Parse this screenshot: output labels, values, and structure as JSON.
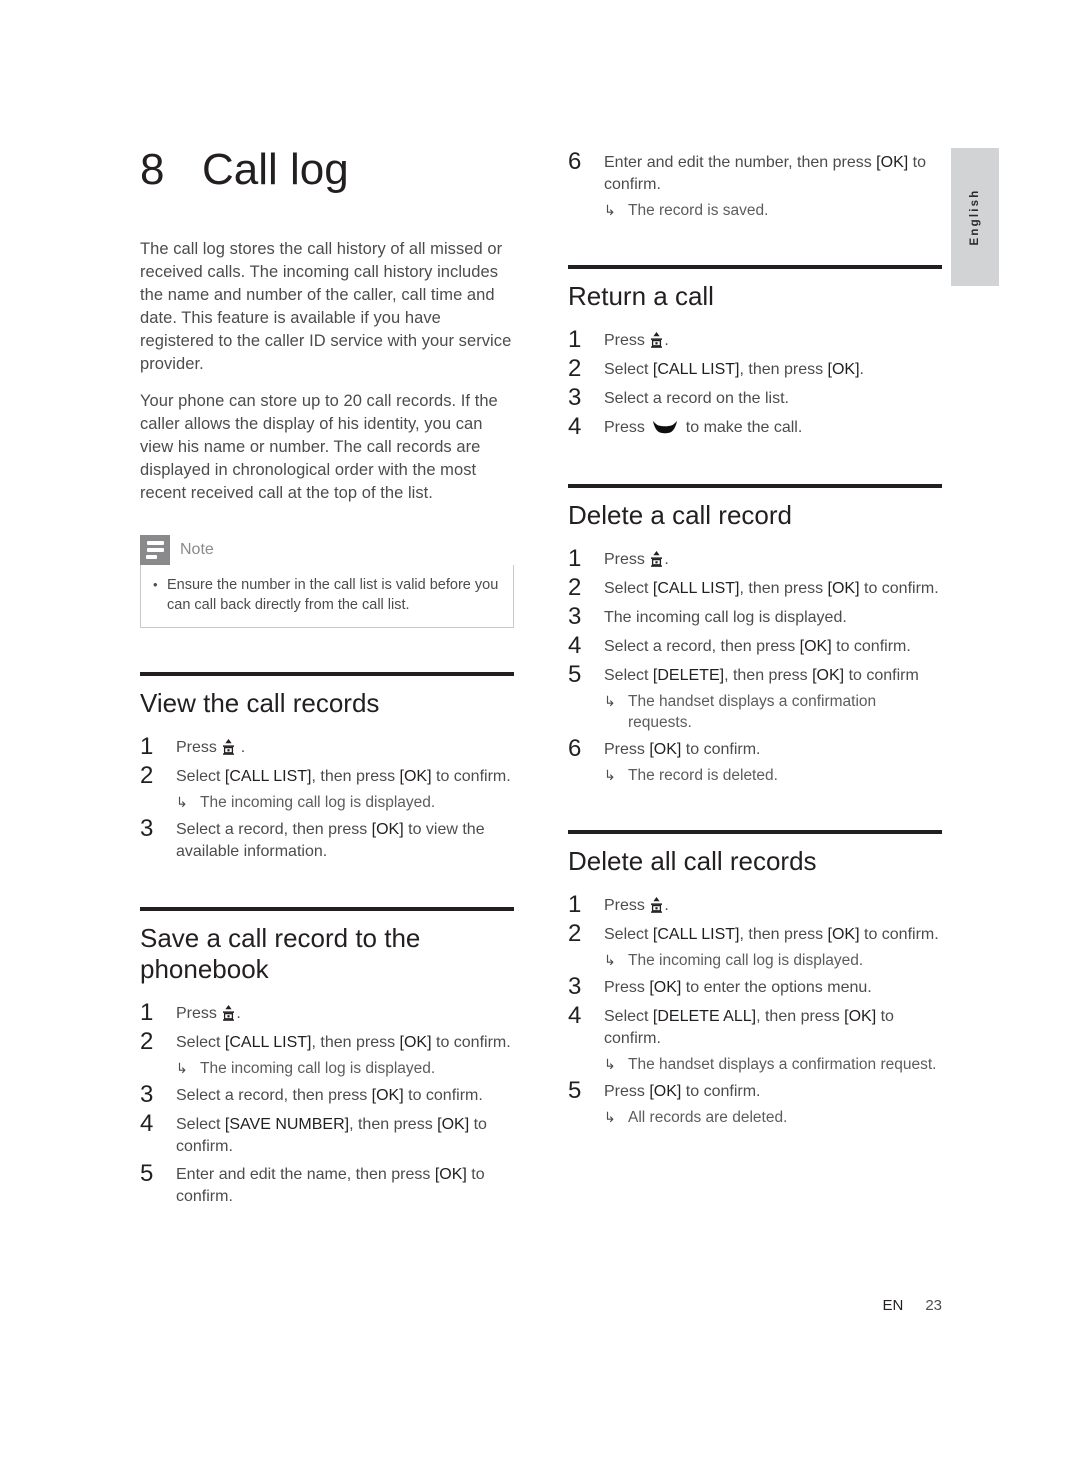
{
  "page": {
    "language_tab": "English",
    "footer": {
      "locale_code": "EN",
      "page_number": "23"
    }
  },
  "chapter": {
    "number": "8",
    "title": "Call log"
  },
  "intro": {
    "paragraph_1": "The call log stores the call history of all missed or received calls. The incoming call history includes the name and number of the caller, call time and date. This feature is available if you have registered to the caller ID service with your service provider.",
    "paragraph_2": "Your phone can store up to 20 call records. If the caller allows the display of his identity, you can view his name or number. The call records are displayed in chronological order with the most recent received call at the top of the list."
  },
  "note": {
    "label": "Note",
    "bullet": "•",
    "items": [
      "Ensure the number in the call list is valid before you can call back directly from the call list."
    ]
  },
  "sections": {
    "view_records": {
      "title": "View the call records",
      "steps": [
        {
          "num": "1",
          "pre": "Press ",
          "icon": "menu-key-icon",
          "post": " ."
        },
        {
          "num": "2",
          "text_parts": [
            "Select ",
            "[CALL LIST]",
            ", then press ",
            "[OK]",
            " to confirm."
          ],
          "result": "The incoming call log is displayed."
        },
        {
          "num": "3",
          "text_parts": [
            "Select a record, then press ",
            "[OK]",
            " to view the available information."
          ]
        }
      ]
    },
    "save_record": {
      "title": "Save a call record to the phonebook",
      "steps": [
        {
          "num": "1",
          "pre": "Press ",
          "icon": "menu-key-icon",
          "post": "."
        },
        {
          "num": "2",
          "text_parts": [
            "Select ",
            "[CALL LIST]",
            ", then press ",
            "[OK]",
            " to confirm."
          ],
          "result": "The incoming call log is displayed."
        },
        {
          "num": "3",
          "text_parts": [
            "Select a record, then press ",
            "[OK]",
            " to confirm."
          ]
        },
        {
          "num": "4",
          "text_parts": [
            "Select ",
            "[SAVE NUMBER]",
            ", then press ",
            "[OK]",
            " to confirm."
          ]
        },
        {
          "num": "5",
          "text_parts": [
            "Enter and edit the name, then press ",
            "[OK]",
            " to confirm."
          ]
        }
      ]
    },
    "save_record_continued": {
      "steps": [
        {
          "num": "6",
          "text_parts": [
            "Enter and edit the number, then press ",
            "[OK]",
            " to confirm."
          ],
          "result": "The record is saved."
        }
      ]
    },
    "return_call": {
      "title": "Return a call",
      "steps": [
        {
          "num": "1",
          "pre": "Press ",
          "icon": "menu-key-icon",
          "post": "."
        },
        {
          "num": "2",
          "text_parts": [
            "Select ",
            "[CALL LIST]",
            ", then press ",
            "[OK]",
            "."
          ]
        },
        {
          "num": "3",
          "text_parts": [
            "Select a record on the list."
          ]
        },
        {
          "num": "4",
          "pre": "Press ",
          "icon": "talk-key-icon",
          "post": " to make the call."
        }
      ]
    },
    "delete_record": {
      "title": "Delete a call record",
      "steps": [
        {
          "num": "1",
          "pre": "Press ",
          "icon": "menu-key-icon",
          "post": "."
        },
        {
          "num": "2",
          "text_parts": [
            "Select ",
            "[CALL LIST]",
            ", then press ",
            "[OK]",
            " to confirm."
          ]
        },
        {
          "num": "3",
          "text_parts": [
            "The incoming call log is displayed."
          ]
        },
        {
          "num": "4",
          "text_parts": [
            "Select a record, then press ",
            "[OK]",
            " to confirm."
          ]
        },
        {
          "num": "5",
          "text_parts": [
            "Select ",
            "[DELETE]",
            ", then press ",
            "[OK]",
            " to confirm"
          ],
          "result": "The handset displays a confirmation requests."
        },
        {
          "num": "6",
          "text_parts": [
            "Press ",
            "[OK]",
            " to confirm."
          ],
          "result": "The record is deleted."
        }
      ]
    },
    "delete_all_records": {
      "title": "Delete all call records",
      "steps": [
        {
          "num": "1",
          "pre": "Press ",
          "icon": "menu-key-icon",
          "post": "."
        },
        {
          "num": "2",
          "text_parts": [
            "Select ",
            "[CALL LIST]",
            ", then press ",
            "[OK]",
            " to confirm."
          ],
          "result": "The incoming call log is displayed."
        },
        {
          "num": "3",
          "text_parts": [
            "Press ",
            "[OK]",
            " to enter the options menu."
          ]
        },
        {
          "num": "4",
          "text_parts": [
            "Select ",
            "[DELETE ALL]",
            ", then press ",
            "[OK]",
            " to confirm."
          ],
          "result": "The handset displays a confirmation request."
        },
        {
          "num": "5",
          "text_parts": [
            "Press ",
            "[OK]",
            " to confirm."
          ],
          "result": "All records are deleted."
        }
      ]
    }
  },
  "strings": {
    "result_arrow": "↳",
    "label_call_list": "[CALL LIST]",
    "label_ok": "[OK]",
    "label_save_number": "[SAVE NUMBER]",
    "label_delete": "[DELETE]",
    "label_delete_all": "[DELETE ALL]"
  }
}
